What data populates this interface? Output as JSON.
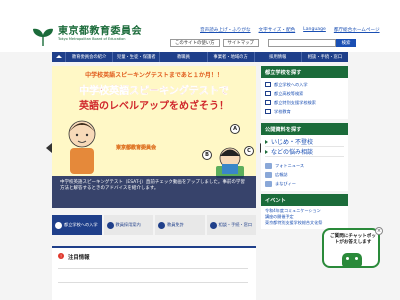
{
  "header": {
    "logo_title": "東京都教育委員会",
    "logo_sub": "Tokyo Metropolitan Board of Education",
    "util_links": [
      "音声読み上げ・ふりがな",
      "文字サイズ・配色",
      "Language",
      "都庁総合ホームページ"
    ],
    "util_buttons": [
      "このサイトの使い方",
      "サイトマップ"
    ],
    "search_label": "検索"
  },
  "nav": {
    "items": [
      "教育委員会の紹介",
      "児童・生徒・保護者",
      "教職員",
      "事業者・地域の方",
      "採用情報",
      "相談・手続・窓口"
    ]
  },
  "banner": {
    "top_line": "中学校英語スピーキングテストまであと１か月！！",
    "headline1": "中学校英語スピーキングテストで",
    "headline2": "英語のレベルアップをめざそう！",
    "sub": "東京都教育委員会",
    "bubbles": [
      "B",
      "C",
      "A"
    ],
    "caption": "中学校英語スピーキングテスト（ESAT-J）直前チェック動画をアップしました。事前の学習方法と解答するときのアドバイスを紹介します。"
  },
  "quicklinks": [
    "都立学校への入学",
    "教員採用案内",
    "教員免許",
    "相談・手続・窓口"
  ],
  "notice": {
    "badge": "!",
    "title": "注目情報"
  },
  "sidebar": {
    "school_head": "都立学校を探す",
    "school_items": [
      "都立学校への入学",
      "都立高校等検索",
      "都立特別支援学校検索",
      "学校教育"
    ],
    "public_head": "公開資料を探す",
    "public_items": [
      "いじめ・不登校",
      "などの悩み相談"
    ],
    "sns_items": [
      "フォトニュース",
      "広報誌",
      "まなびィー"
    ],
    "event_head": "イベント",
    "events": [
      "令和4年度コミュニケーション",
      "講座の開催予定",
      "東京都特別支援学校総合文化祭"
    ]
  },
  "chat": {
    "text": "ご質問にチャットボットがお答えします",
    "close": "×"
  },
  "colors": {
    "brand_green": "#1b6b3a",
    "nav_blue": "#1f3f8a",
    "link_blue": "#1a4fb3",
    "banner_red": "#d0272c",
    "banner_bg": "#fff8c6"
  }
}
